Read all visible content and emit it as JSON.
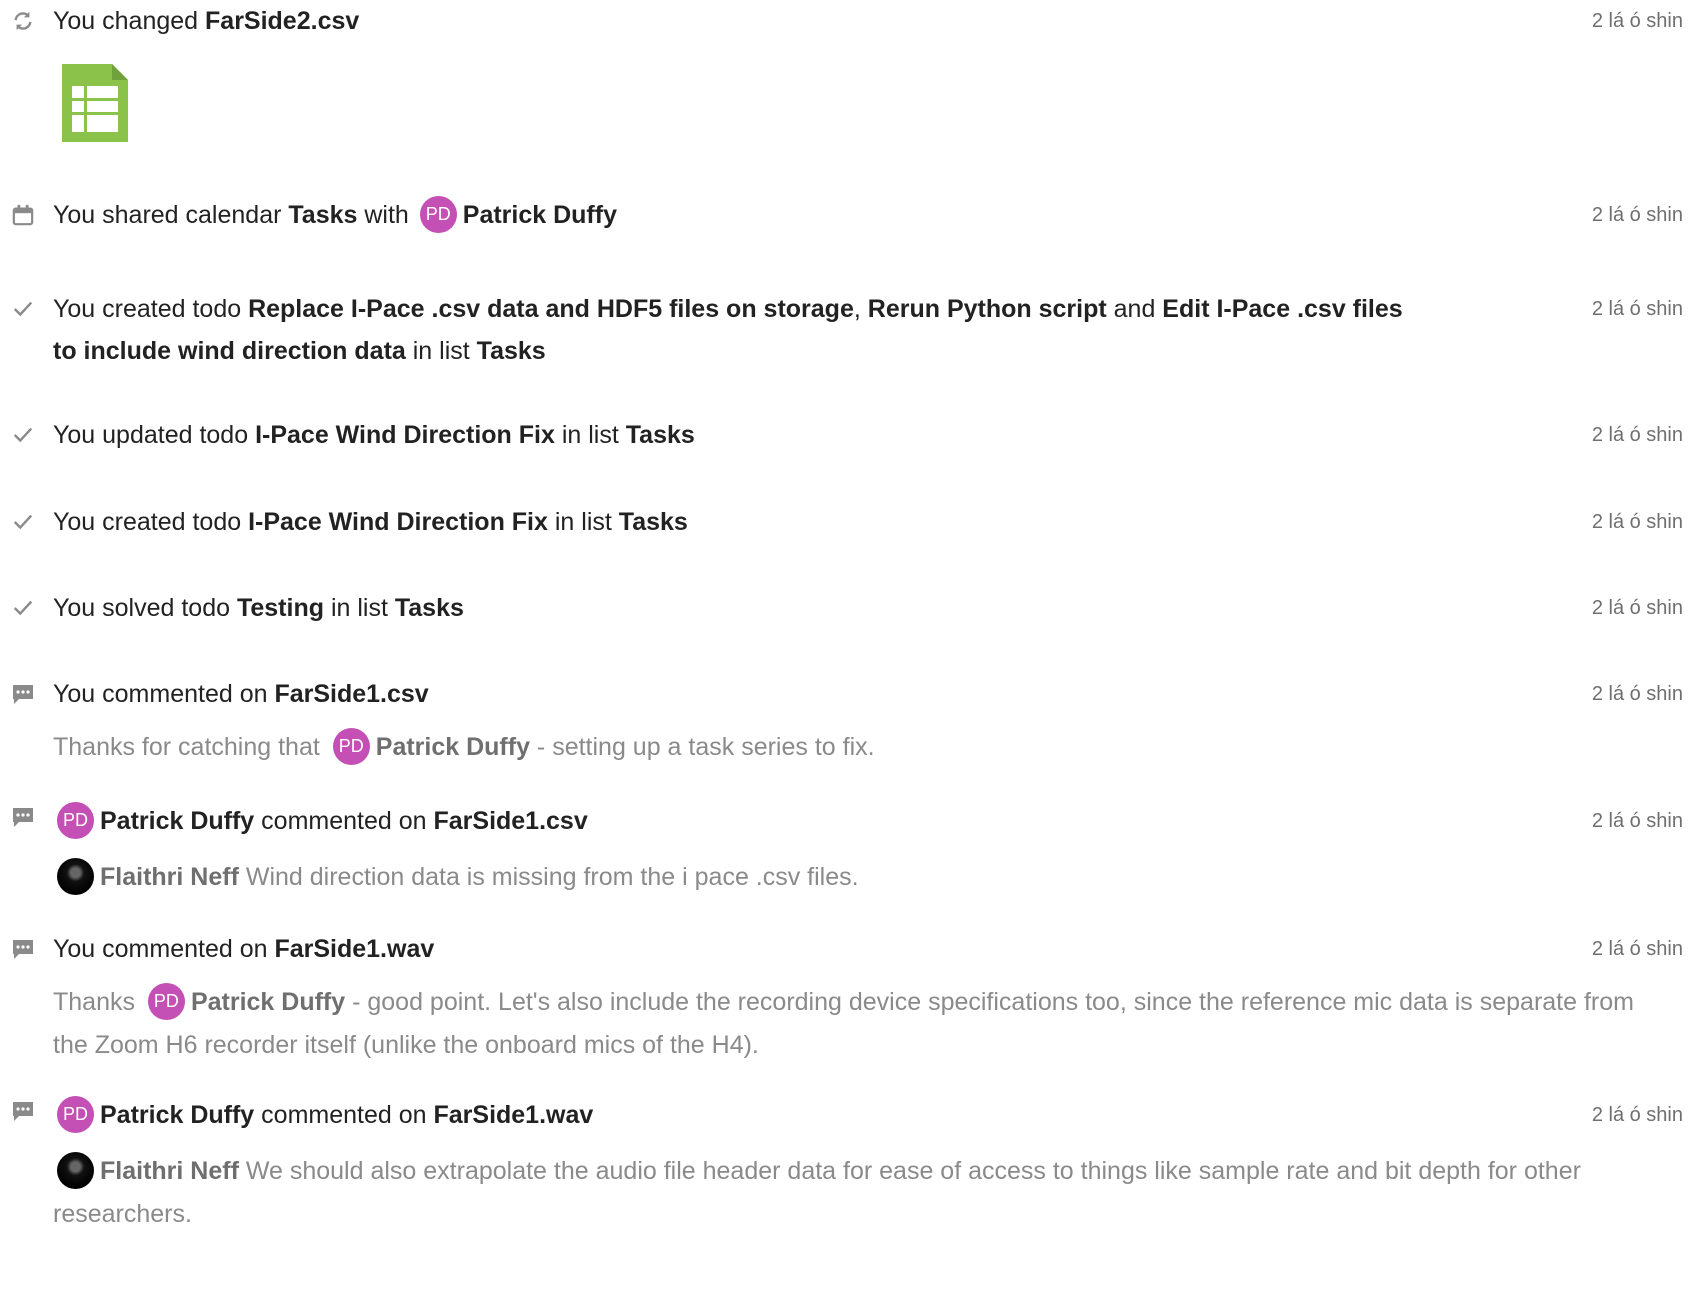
{
  "colors": {
    "avatar_bg": "#c44fb5",
    "file_icon": "#8bc34a",
    "muted_text": "#8a8a8a",
    "timestamp": "#6f6f6f"
  },
  "entries": [
    {
      "icon": "refresh-icon",
      "prefix": "You changed ",
      "file": "FarSide2.csv",
      "time": "2 lá ó shin",
      "attachment_icon": "spreadsheet-file-icon"
    },
    {
      "icon": "calendar-icon",
      "prefix": "You shared calendar ",
      "calendar": "Tasks",
      "mid": " with ",
      "avatar": "PD",
      "user": "Patrick Duffy",
      "time": "2 lá ó shin"
    },
    {
      "icon": "check-icon",
      "prefix": "You created todo ",
      "todo1": "Replace I-Pace .csv data and HDF5 files on storage",
      "sep1": ", ",
      "todo2": "Rerun Python script",
      "sep2": " and ",
      "todo3": "Edit I-Pace .csv files to include wind direction data",
      "mid": " in list ",
      "list": "Tasks",
      "time": "2 lá ó shin"
    },
    {
      "icon": "check-icon",
      "prefix": "You updated todo ",
      "todo": "I-Pace Wind Direction Fix",
      "mid": " in list ",
      "list": "Tasks",
      "time": "2 lá ó shin"
    },
    {
      "icon": "check-icon",
      "prefix": "You created todo ",
      "todo": "I-Pace Wind Direction Fix",
      "mid": " in list ",
      "list": "Tasks",
      "time": "2 lá ó shin"
    },
    {
      "icon": "check-icon",
      "prefix": "You solved todo ",
      "todo": "Testing",
      "mid": " in list ",
      "list": "Tasks",
      "time": "2 lá ó shin"
    },
    {
      "icon": "comment-icon",
      "prefix": "You commented on ",
      "file": "FarSide1.csv",
      "time": "2 lá ó shin",
      "comment_before": "Thanks for catching that ",
      "comment_avatar": "PD",
      "comment_user": "Patrick Duffy",
      "comment_after": " - setting up a task series to fix."
    },
    {
      "icon": "comment-icon",
      "avatar": "PD",
      "user": "Patrick Duffy",
      "mid": " commented on ",
      "file": "FarSide1.csv",
      "time": "2 lá ó shin",
      "comment_user": "Flaithri Neff",
      "comment_text": " Wind direction data is missing from the i pace .csv files."
    },
    {
      "icon": "comment-icon",
      "prefix": "You commented on ",
      "file": "FarSide1.wav",
      "time": "2 lá ó shin",
      "comment_before": "Thanks ",
      "comment_avatar": "PD",
      "comment_user": "Patrick Duffy",
      "comment_after": " - good point. Let's also include the recording device specifications too, since the reference mic data is separate from the Zoom H6 recorder itself (unlike the onboard mics of the H4)."
    },
    {
      "icon": "comment-icon",
      "avatar": "PD",
      "user": "Patrick Duffy",
      "mid": " commented on ",
      "file": "FarSide1.wav",
      "time": "2 lá ó shin",
      "comment_user": "Flaithri Neff",
      "comment_text": " We should also extrapolate the audio file header data for ease of access to things like sample rate and bit depth for other researchers."
    }
  ]
}
